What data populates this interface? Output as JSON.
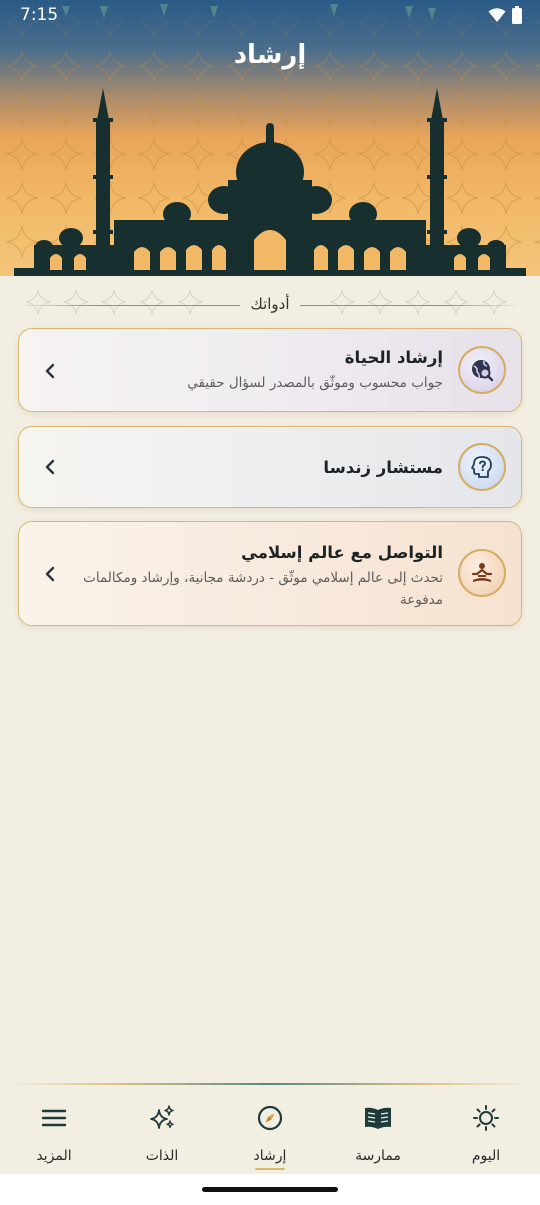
{
  "status_bar": {
    "time": "7:15"
  },
  "header": {
    "title": "إرشاد"
  },
  "section": {
    "label": "أدواتك"
  },
  "cards": [
    {
      "title": "إرشاد الحياة",
      "description": "جواب محسوب وموثّق بالمصدر لسؤال حقيقي",
      "icon": "globe-search-icon"
    },
    {
      "title": "مستشار زندسا",
      "description": "",
      "icon": "head-question-icon"
    },
    {
      "title": "التواصل مع عالم إسلامي",
      "description": "تحدث إلى عالم إسلامي موثّق - دردشة مجانية، وإرشاد ومكالمات مدفوعة",
      "icon": "meditating-person-icon"
    }
  ],
  "bottom_nav": {
    "items": [
      {
        "label": "اليوم",
        "icon": "sun-icon",
        "active": false
      },
      {
        "label": "ممارسة",
        "icon": "book-icon",
        "active": false
      },
      {
        "label": "إرشاد",
        "icon": "compass-icon",
        "active": true
      },
      {
        "label": "الذات",
        "icon": "sparkles-icon",
        "active": false
      },
      {
        "label": "المزيد",
        "icon": "menu-icon",
        "active": false
      }
    ]
  },
  "colors": {
    "accent_gold": "#d7b870",
    "teal": "#1f3a3a",
    "background": "#f3eee2"
  }
}
